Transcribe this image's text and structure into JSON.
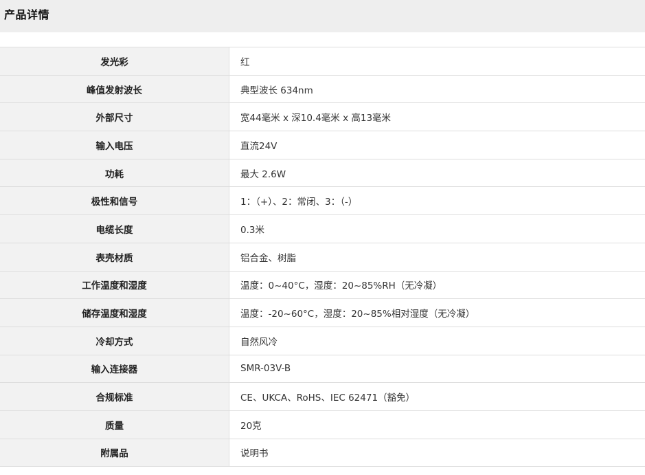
{
  "header": {
    "title": "产品详情"
  },
  "specs": [
    {
      "label": "发光彩",
      "value": "红"
    },
    {
      "label": "峰值发射波长",
      "value": "典型波长 634nm"
    },
    {
      "label": "外部尺寸",
      "value": "宽44毫米 x 深10.4毫米 x 高13毫米"
    },
    {
      "label": "输入电压",
      "value": "直流24V"
    },
    {
      "label": "功耗",
      "value": "最大 2.6W"
    },
    {
      "label": "极性和信号",
      "value": "1：（+）、2：常闭、3：（-）"
    },
    {
      "label": "电缆长度",
      "value": "0.3米"
    },
    {
      "label": "表壳材质",
      "value": "铝合金、树脂"
    },
    {
      "label": "工作温度和湿度",
      "value": "温度：0~40°C，湿度：20~85%RH（无冷凝）"
    },
    {
      "label": "储存温度和湿度",
      "value": "温度：-20~60°C，湿度：20~85%相对湿度（无冷凝）"
    },
    {
      "label": "冷却方式",
      "value": "自然风冷"
    },
    {
      "label": "输入连接器",
      "value": "SMR-03V-B"
    },
    {
      "label": "合规标准",
      "value": "CE、UKCA、RoHS、IEC 62471（豁免）"
    },
    {
      "label": "质量",
      "value": "20克"
    },
    {
      "label": "附属品",
      "value": "说明书"
    }
  ]
}
